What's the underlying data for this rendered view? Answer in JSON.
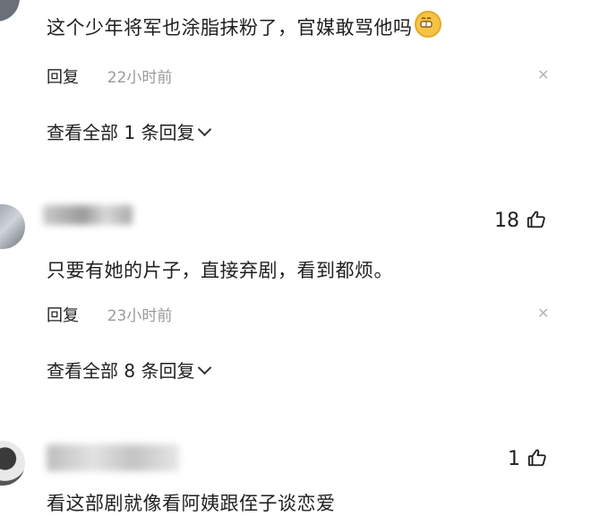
{
  "comments": [
    {
      "text": "这个少年将军也涂脂抹粉了，官媒敢骂他吗",
      "reply_label": "回复",
      "time": "22小时前",
      "view_replies": "查看全部 1 条回复"
    },
    {
      "likes": "18",
      "text": "只要有她的片子，直接弃剧，看到都烦。",
      "reply_label": "回复",
      "time": "23小时前",
      "view_replies": "查看全部 8 条回复"
    },
    {
      "likes": "1",
      "text": "看这部剧就像看阿姨跟侄子谈恋爱"
    }
  ],
  "icons": {
    "close": "close-icon",
    "like": "thumbs-up-icon",
    "expand": "chevron-down-icon",
    "emoji": "grinning-emoji-icon"
  },
  "colors": {
    "text": "#1f1f1f",
    "timestamp": "#9a9a9a",
    "close": "#b5b5b5"
  }
}
